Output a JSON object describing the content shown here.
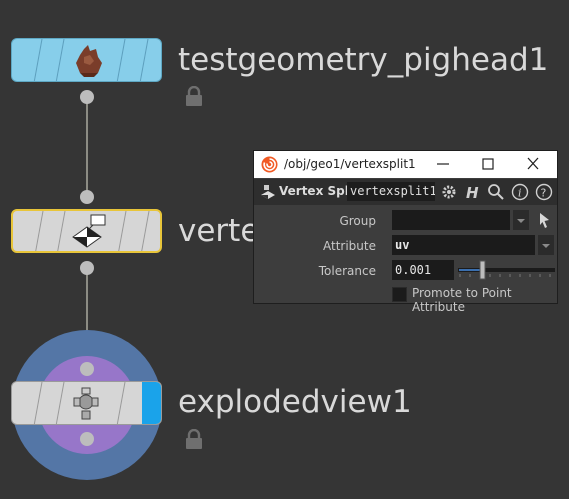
{
  "network": {
    "nodes": [
      {
        "name": "testgeometry_pighead1",
        "icon": "pig-head-icon",
        "color": "#87ceea",
        "locked": true
      },
      {
        "name": "vertexsplit1",
        "visible_label": "verte",
        "icon": "vertex-split-icon",
        "color": "#d6d6d6",
        "selected": true
      },
      {
        "name": "explodedview1",
        "icon": "exploded-view-icon",
        "color": "#d6d6d6",
        "display_flag_color": "#1aa3ea",
        "locked": true
      }
    ]
  },
  "param_window": {
    "title_icon": "houdini-swirl-icon",
    "path": "/obj/geo1/vertexsplit1",
    "buttons": [
      "minimize",
      "maximize",
      "close"
    ],
    "op_type": "Vertex Split",
    "node_name": "vertexsplit1",
    "toolbar_icons": [
      "gear-icon",
      "help-h-icon",
      "search-icon",
      "info-icon",
      "question-icon"
    ],
    "params": {
      "group": {
        "label": "Group",
        "value": ""
      },
      "attribute": {
        "label": "Attribute",
        "value": "uv"
      },
      "tolerance": {
        "label": "Tolerance",
        "value": "0.001",
        "slider_fraction": 0.25
      },
      "promote": {
        "label": "Promote to Point Attribute",
        "checked": false
      }
    }
  }
}
